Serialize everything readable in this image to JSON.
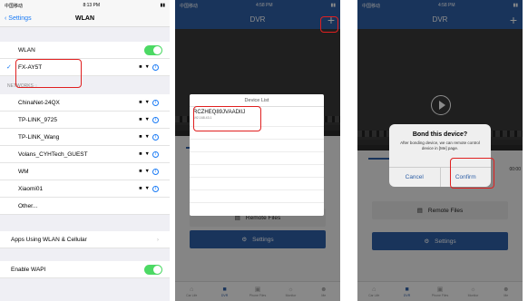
{
  "settings": {
    "status": {
      "carrier": "中国移动",
      "time": "8:13 PM"
    },
    "back": "Settings",
    "title": "WLAN",
    "wlan_label": "WLAN",
    "connected": "FX-AY5T",
    "networks_header": "NETWORKS",
    "networks": [
      "ChinaNet-24QX",
      "TP-LINK_9725",
      "TP-LINK_Wang",
      "Volans_CYHTech_GUEST",
      "WM",
      "Xiaomi01"
    ],
    "other": "Other...",
    "apps_row": "Apps Using WLAN & Cellular",
    "wapi_row": "Enable WAPI"
  },
  "dvr_list": {
    "status": {
      "carrier": "中国移动",
      "time": "4:58 PM"
    },
    "title": "DVR",
    "plus": "+",
    "list_title": "Device List",
    "device_id": "RCZHEQ89JVAADIIJ",
    "device_ip": "192.168.43.1",
    "remote_files": "Remote Files",
    "settings_label": "Settings",
    "tabs": [
      "Car Life",
      "DVR",
      "Phone Files",
      "Monitor",
      "Me"
    ]
  },
  "dvr_bond": {
    "status": {
      "carrier": "中国移动",
      "time": "4:58 PM"
    },
    "title": "DVR",
    "plus": "+",
    "dialog_title": "Bond this device?",
    "dialog_msg": "After bonding device, we can remote control device in [Me] page.",
    "cancel": "Cancel",
    "confirm": "Confirm",
    "time_frag": "00:00",
    "remote_files": "Remote Files",
    "settings_label": "Settings",
    "tabs": [
      "Car Life",
      "DVR",
      "Phone Files",
      "Monitor",
      "Me"
    ]
  },
  "colors": {
    "accent": "#2e5fa6",
    "ios_blue": "#1a7bf5",
    "highlight": "#e02020",
    "toggle_on": "#4cd964"
  }
}
